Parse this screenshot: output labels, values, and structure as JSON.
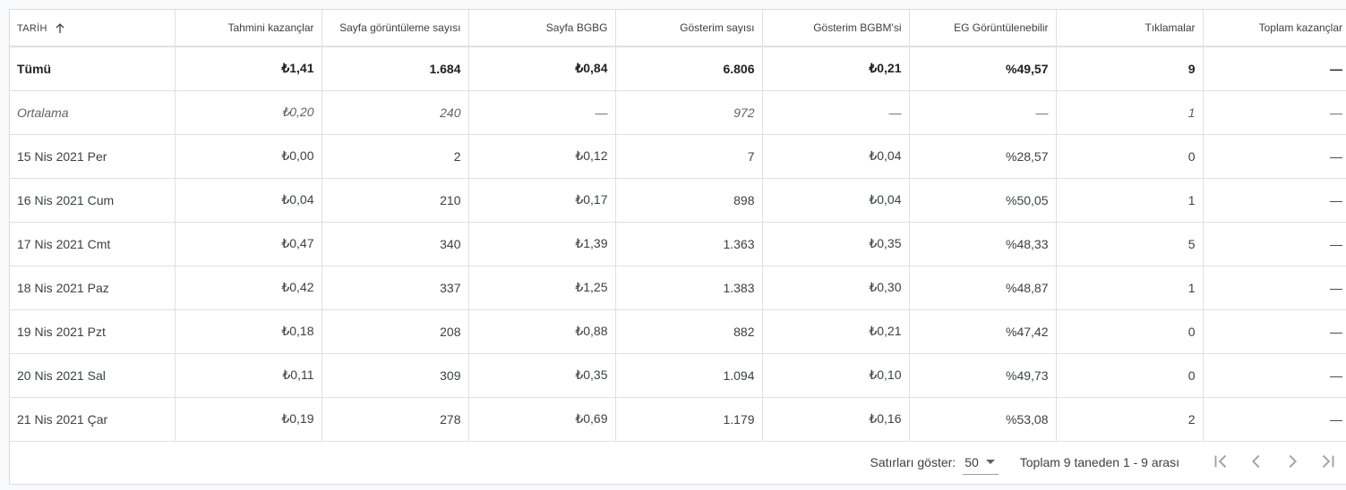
{
  "table": {
    "headers": [
      "TARİH",
      "Tahmini kazançlar",
      "Sayfa görüntüleme sayısı",
      "Sayfa BGBG",
      "Gösterim sayısı",
      "Gösterim BGBM'si",
      "EG Görüntülenebilir",
      "Tıklamalar",
      "Toplam kazançlar"
    ],
    "total_row": [
      "Tümü",
      "₺1,41",
      "1.684",
      "₺0,84",
      "6.806",
      "₺0,21",
      "%49,57",
      "9",
      "—"
    ],
    "average_row": [
      "Ortalama",
      "₺0,20",
      "240",
      "—",
      "972",
      "—",
      "—",
      "1",
      "—"
    ],
    "rows": [
      [
        "15 Nis 2021 Per",
        "₺0,00",
        "2",
        "₺0,12",
        "7",
        "₺0,04",
        "%28,57",
        "0",
        "—"
      ],
      [
        "16 Nis 2021 Cum",
        "₺0,04",
        "210",
        "₺0,17",
        "898",
        "₺0,04",
        "%50,05",
        "1",
        "—"
      ],
      [
        "17 Nis 2021 Cmt",
        "₺0,47",
        "340",
        "₺1,39",
        "1.363",
        "₺0,35",
        "%48,33",
        "5",
        "—"
      ],
      [
        "18 Nis 2021 Paz",
        "₺0,42",
        "337",
        "₺1,25",
        "1.383",
        "₺0,30",
        "%48,87",
        "1",
        "—"
      ],
      [
        "19 Nis 2021 Pzt",
        "₺0,18",
        "208",
        "₺0,88",
        "882",
        "₺0,21",
        "%47,42",
        "0",
        "—"
      ],
      [
        "20 Nis 2021 Sal",
        "₺0,11",
        "309",
        "₺0,35",
        "1.094",
        "₺0,10",
        "%49,73",
        "0",
        "—"
      ],
      [
        "21 Nis 2021 Çar",
        "₺0,19",
        "278",
        "₺0,69",
        "1.179",
        "₺0,16",
        "%53,08",
        "2",
        "—"
      ]
    ]
  },
  "footer": {
    "rows_label": "Satırları göster:",
    "rows_value": "50",
    "range_text": "Toplam 9 taneden 1 - 9 arası"
  },
  "icons": {
    "sort": "arrow-up-icon",
    "first_page": "first-page-icon",
    "prev_page": "chevron-left-icon",
    "next_page": "chevron-right-icon",
    "last_page": "last-page-icon"
  },
  "colors": {
    "border": "#e0e0e0",
    "text": "#3c4043",
    "icon_disabled": "#9aa0a6"
  }
}
